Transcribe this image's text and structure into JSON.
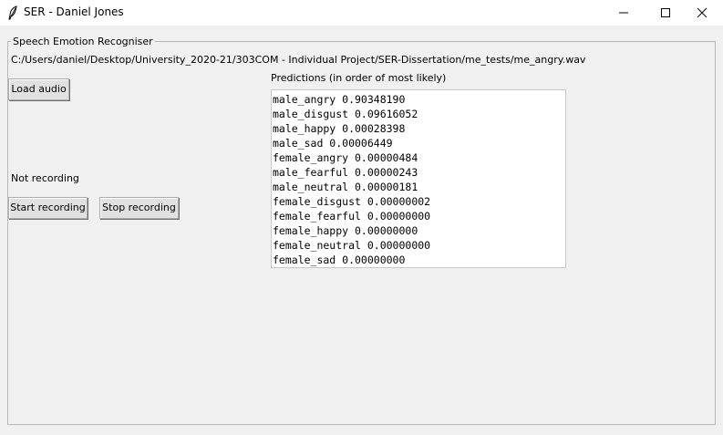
{
  "window": {
    "title": "SER - Daniel Jones",
    "app_icon": "feather-icon"
  },
  "group": {
    "legend": "Speech Emotion Recogniser"
  },
  "file_path": "C:/Users/daniel/Desktop/University_2020-21/303COM - Individual Project/SER-Dissertation/me_tests/me_angry.wav",
  "buttons": {
    "load_audio": "Load audio",
    "start_recording": "Start recording",
    "stop_recording": "Stop recording"
  },
  "recording_status": "Not recording",
  "predictions": {
    "label": "Predictions (in order of most likely)",
    "items": [
      "male_angry 0.90348190",
      "male_disgust 0.09616052",
      "male_happy 0.00028398",
      "male_sad 0.00006449",
      "female_angry 0.00000484",
      "male_fearful 0.00000243",
      "male_neutral 0.00000181",
      "female_disgust 0.00000002",
      "female_fearful 0.00000000",
      "female_happy 0.00000000",
      "female_neutral 0.00000000",
      "female_sad 0.00000000"
    ]
  }
}
